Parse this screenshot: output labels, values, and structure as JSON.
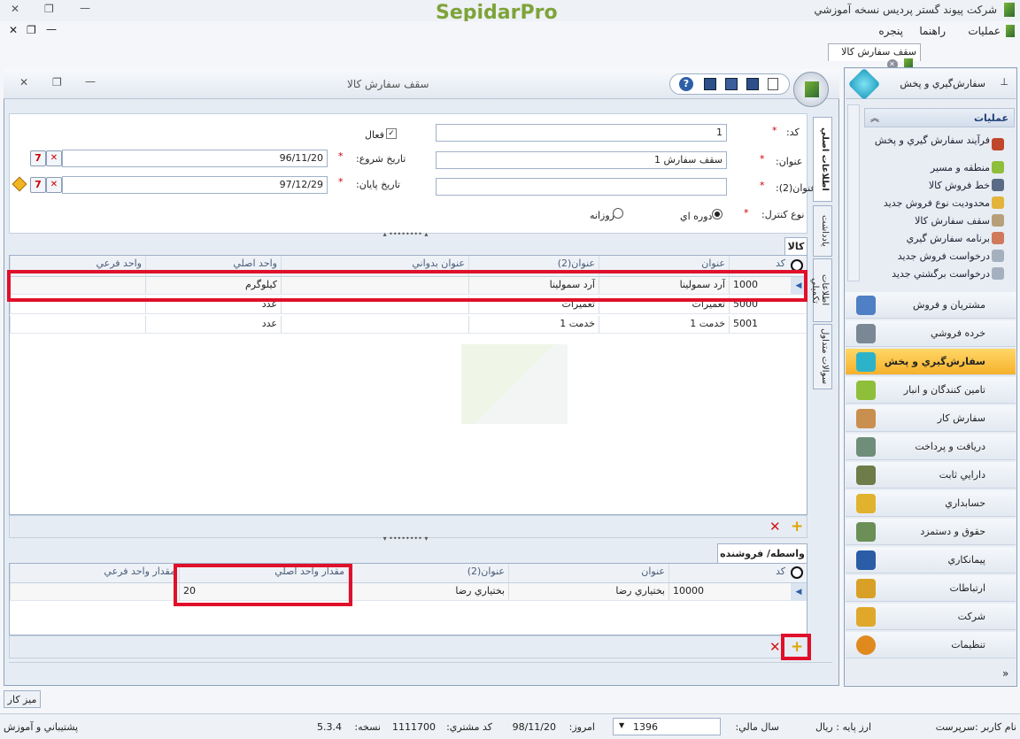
{
  "app": {
    "title": "شرکت پيوند گستر پرديس نسخه آموزشي",
    "logo": "SepidarPro"
  },
  "menu": {
    "items": [
      "عمليات",
      "راهنما",
      "پنجره"
    ]
  },
  "doc_tab": {
    "label": "سقف سفارش کالا"
  },
  "form": {
    "title": "سقف سفارش کالا",
    "code_label": "کد:",
    "code_value": "1",
    "active_label": "فعال",
    "title_label": "عنوان:",
    "title_value": "سقف سفارش 1",
    "title2_label": "عنوان(2):",
    "title2_value": "",
    "start_label": "تاريخ شروع:",
    "start_value": "96/11/20",
    "end_label": "تاريخ پايان:",
    "end_value": "97/12/29",
    "control_label": "نوع کنترل:",
    "period_label": "دوره اي",
    "daily_label": "روزانه",
    "side_tabs": [
      "اطلاعات اصلي",
      "يادداشت",
      "اطلاعات تکميلي",
      "سوالات متداول"
    ]
  },
  "goods": {
    "tab": "کالا",
    "headers": [
      "کد",
      "عنوان",
      "عنوان(2)",
      "عنوان بدواني",
      "واحد اصلي",
      "واحد فرعي"
    ],
    "rows": [
      {
        "code": "1000",
        "title": "آرد سمولينا",
        "title2": "آرد سمولينا",
        "alt": "",
        "unit": "کيلوگرم",
        "sub": ""
      },
      {
        "code": "5000",
        "title": "تعميرات",
        "title2": "تعميرات",
        "alt": "",
        "unit": "عدد",
        "sub": ""
      },
      {
        "code": "5001",
        "title": "خدمت 1",
        "title2": "خدمت 1",
        "alt": "",
        "unit": "عدد",
        "sub": ""
      }
    ]
  },
  "agents": {
    "tab": "واسطه/ فروشنده",
    "headers": [
      "کد",
      "عنوان",
      "عنوان(2)",
      "مقدار واحد اصلي",
      "مقدار واحد فرعي"
    ],
    "rows": [
      {
        "code": "10000",
        "title": "بختياري رضا",
        "title2": "بختياري رضا",
        "qty": "20",
        "sub": ""
      }
    ]
  },
  "sidebar": {
    "module_title": "سفارش‌گيري و پخش",
    "ops_title": "عمليات",
    "ops": [
      "فرآيند سفارش گيري و پخش",
      "منطقه و مسير",
      "خط فروش کالا",
      "محدوديت نوع فروش جديد",
      "سقف سفارش کالا",
      "برنامه سفارش گيري",
      "درخواست فروش جديد",
      "درخواست برگشتي جديد"
    ],
    "nav": [
      "مشتريان و فروش",
      "خرده فروشي",
      "سفارش‌گيري و پخش",
      "تامين کنندگان و انبار",
      "سفارش کار",
      "دريافت و پرداخت",
      "دارايي ثابت",
      "حسابداري",
      "حقوق و دستمزد",
      "پيمانکاري",
      "ارتباطات",
      "شرکت",
      "تنظيمات"
    ]
  },
  "taskbar": {
    "desk": "ميز کار"
  },
  "status": {
    "user": "نام کاربر :سرپرست",
    "currency": "ارز پايه : ريال",
    "fy_label": "سال مالي:",
    "fy": "1396",
    "today_label": "امروز:",
    "today": "98/11/20",
    "cust_label": "کد مشتري:",
    "cust": "1111700",
    "ver_label": "نسخه:",
    "ver": "5.3.4",
    "support": "پشتيباني و آموزش"
  }
}
